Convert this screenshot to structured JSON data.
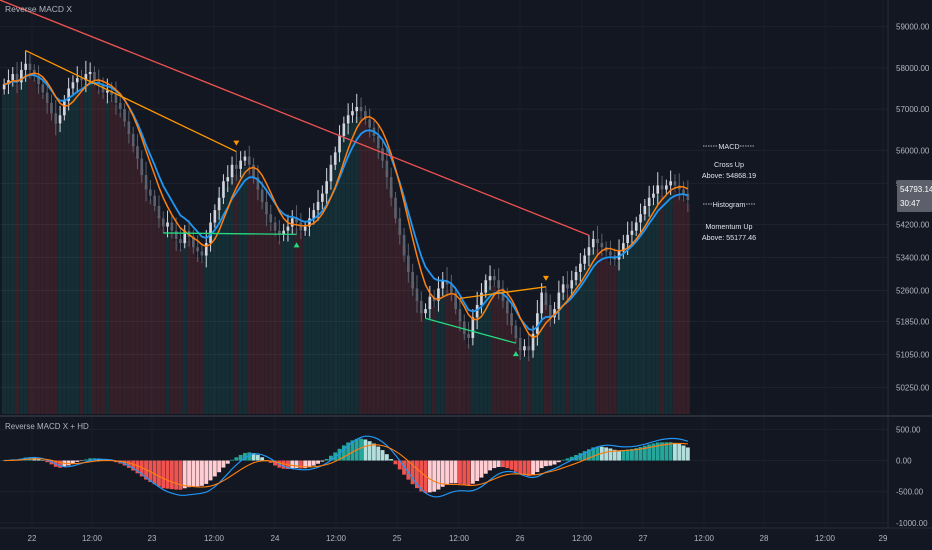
{
  "main_pane": {
    "title": "Reverse MACD X",
    "info_macd_header": "MACD",
    "info_macd_line1": "Cross Up",
    "info_macd_line2": "Above: 54868.19",
    "info_hist_header": "Histogram",
    "info_hist_line1": "Momentum Up",
    "info_hist_line2": "Above: 55177.46",
    "price_tag": "54793.14",
    "countdown": "30:47"
  },
  "sub_pane": {
    "title": "Reverse MACD X + HD"
  },
  "colors": {
    "background": "#131722",
    "bull_candle": "#d1d4dc",
    "bear_candle": "#5d606b",
    "fast_line": "#2196f3",
    "slow_line": "#ff7f0e",
    "bear_div": "#ff9800",
    "bull_div": "#26d97f",
    "red_div": "#ef5350",
    "hist_up_strong": "#26a69a",
    "hist_up_weak": "#b2dfdb",
    "hist_down_strong": "#ef5350",
    "hist_down_weak": "#ffcdd2"
  },
  "chart_data": [
    {
      "type": "candlestick",
      "y_axis_ticks": [
        59000,
        58000,
        57000,
        56000,
        55200,
        54200,
        53400,
        52600,
        51850,
        51050,
        50250
      ],
      "y_axis_tick_labels": [
        "59000.00",
        "58000.00",
        "57000.00",
        "56000.00",
        "55200.00",
        "54200.00",
        "53400.00",
        "52600.00",
        "51850.00",
        "51050.00",
        "50250.00"
      ],
      "ylim": [
        49800,
        59500
      ],
      "x_ticks": [
        "22",
        "12:00",
        "23",
        "12:00",
        "24",
        "12:00",
        "25",
        "12:00",
        "26",
        "12:00",
        "27",
        "12:00",
        "28",
        "12:00",
        "29"
      ],
      "close_series": [
        57600,
        57700,
        57850,
        57650,
        57950,
        58100,
        57950,
        57800,
        57600,
        57400,
        57150,
        56900,
        56650,
        56850,
        57200,
        57500,
        57650,
        57750,
        57700,
        57850,
        57900,
        57700,
        57600,
        57400,
        57450,
        57350,
        57150,
        57000,
        56700,
        56400,
        56100,
        55800,
        55400,
        55050,
        54900,
        54650,
        54350,
        54150,
        54250,
        54050,
        53850,
        53750,
        54050,
        53900,
        53650,
        53550,
        53450,
        53750,
        54250,
        54550,
        54850,
        55250,
        55350,
        55650,
        55550,
        55750,
        55850,
        55650,
        55350,
        55050,
        54750,
        54450,
        54250,
        54050,
        53950,
        54050,
        54150,
        54350,
        54250,
        54050,
        54150,
        54350,
        54550,
        54750,
        54950,
        55250,
        55650,
        55950,
        56350,
        56650,
        56850,
        56950,
        57050,
        56950,
        56750,
        56550,
        56350,
        56050,
        55750,
        55350,
        54850,
        54350,
        53950,
        53450,
        53050,
        52650,
        52350,
        52050,
        52150,
        52450,
        52350,
        52650,
        52850,
        52750,
        52550,
        52150,
        51850,
        51550,
        51450,
        51950,
        52250,
        52550,
        52850,
        52950,
        52850,
        52650,
        52350,
        52050,
        51750,
        51450,
        51150,
        51250,
        51150,
        51550,
        52050,
        52550,
        52250,
        51950,
        52150,
        52550,
        52750,
        52650,
        52850,
        53050,
        53250,
        53450,
        53650,
        53850,
        53750,
        53650,
        53550,
        53450,
        53350,
        53550,
        53750,
        53950,
        54050,
        54250,
        54450,
        54650,
        54850,
        54950,
        55150,
        55050,
        55150,
        55250,
        55150,
        55050,
        54950,
        54793
      ]
    },
    {
      "type": "bar",
      "name": "histogram",
      "y_axis_ticks": [
        500,
        0,
        -500,
        -1000
      ],
      "y_axis_tick_labels": [
        "500.00",
        "0.00",
        "-500.00",
        "-1000.00"
      ],
      "ylim": [
        -1050,
        650
      ]
    }
  ]
}
